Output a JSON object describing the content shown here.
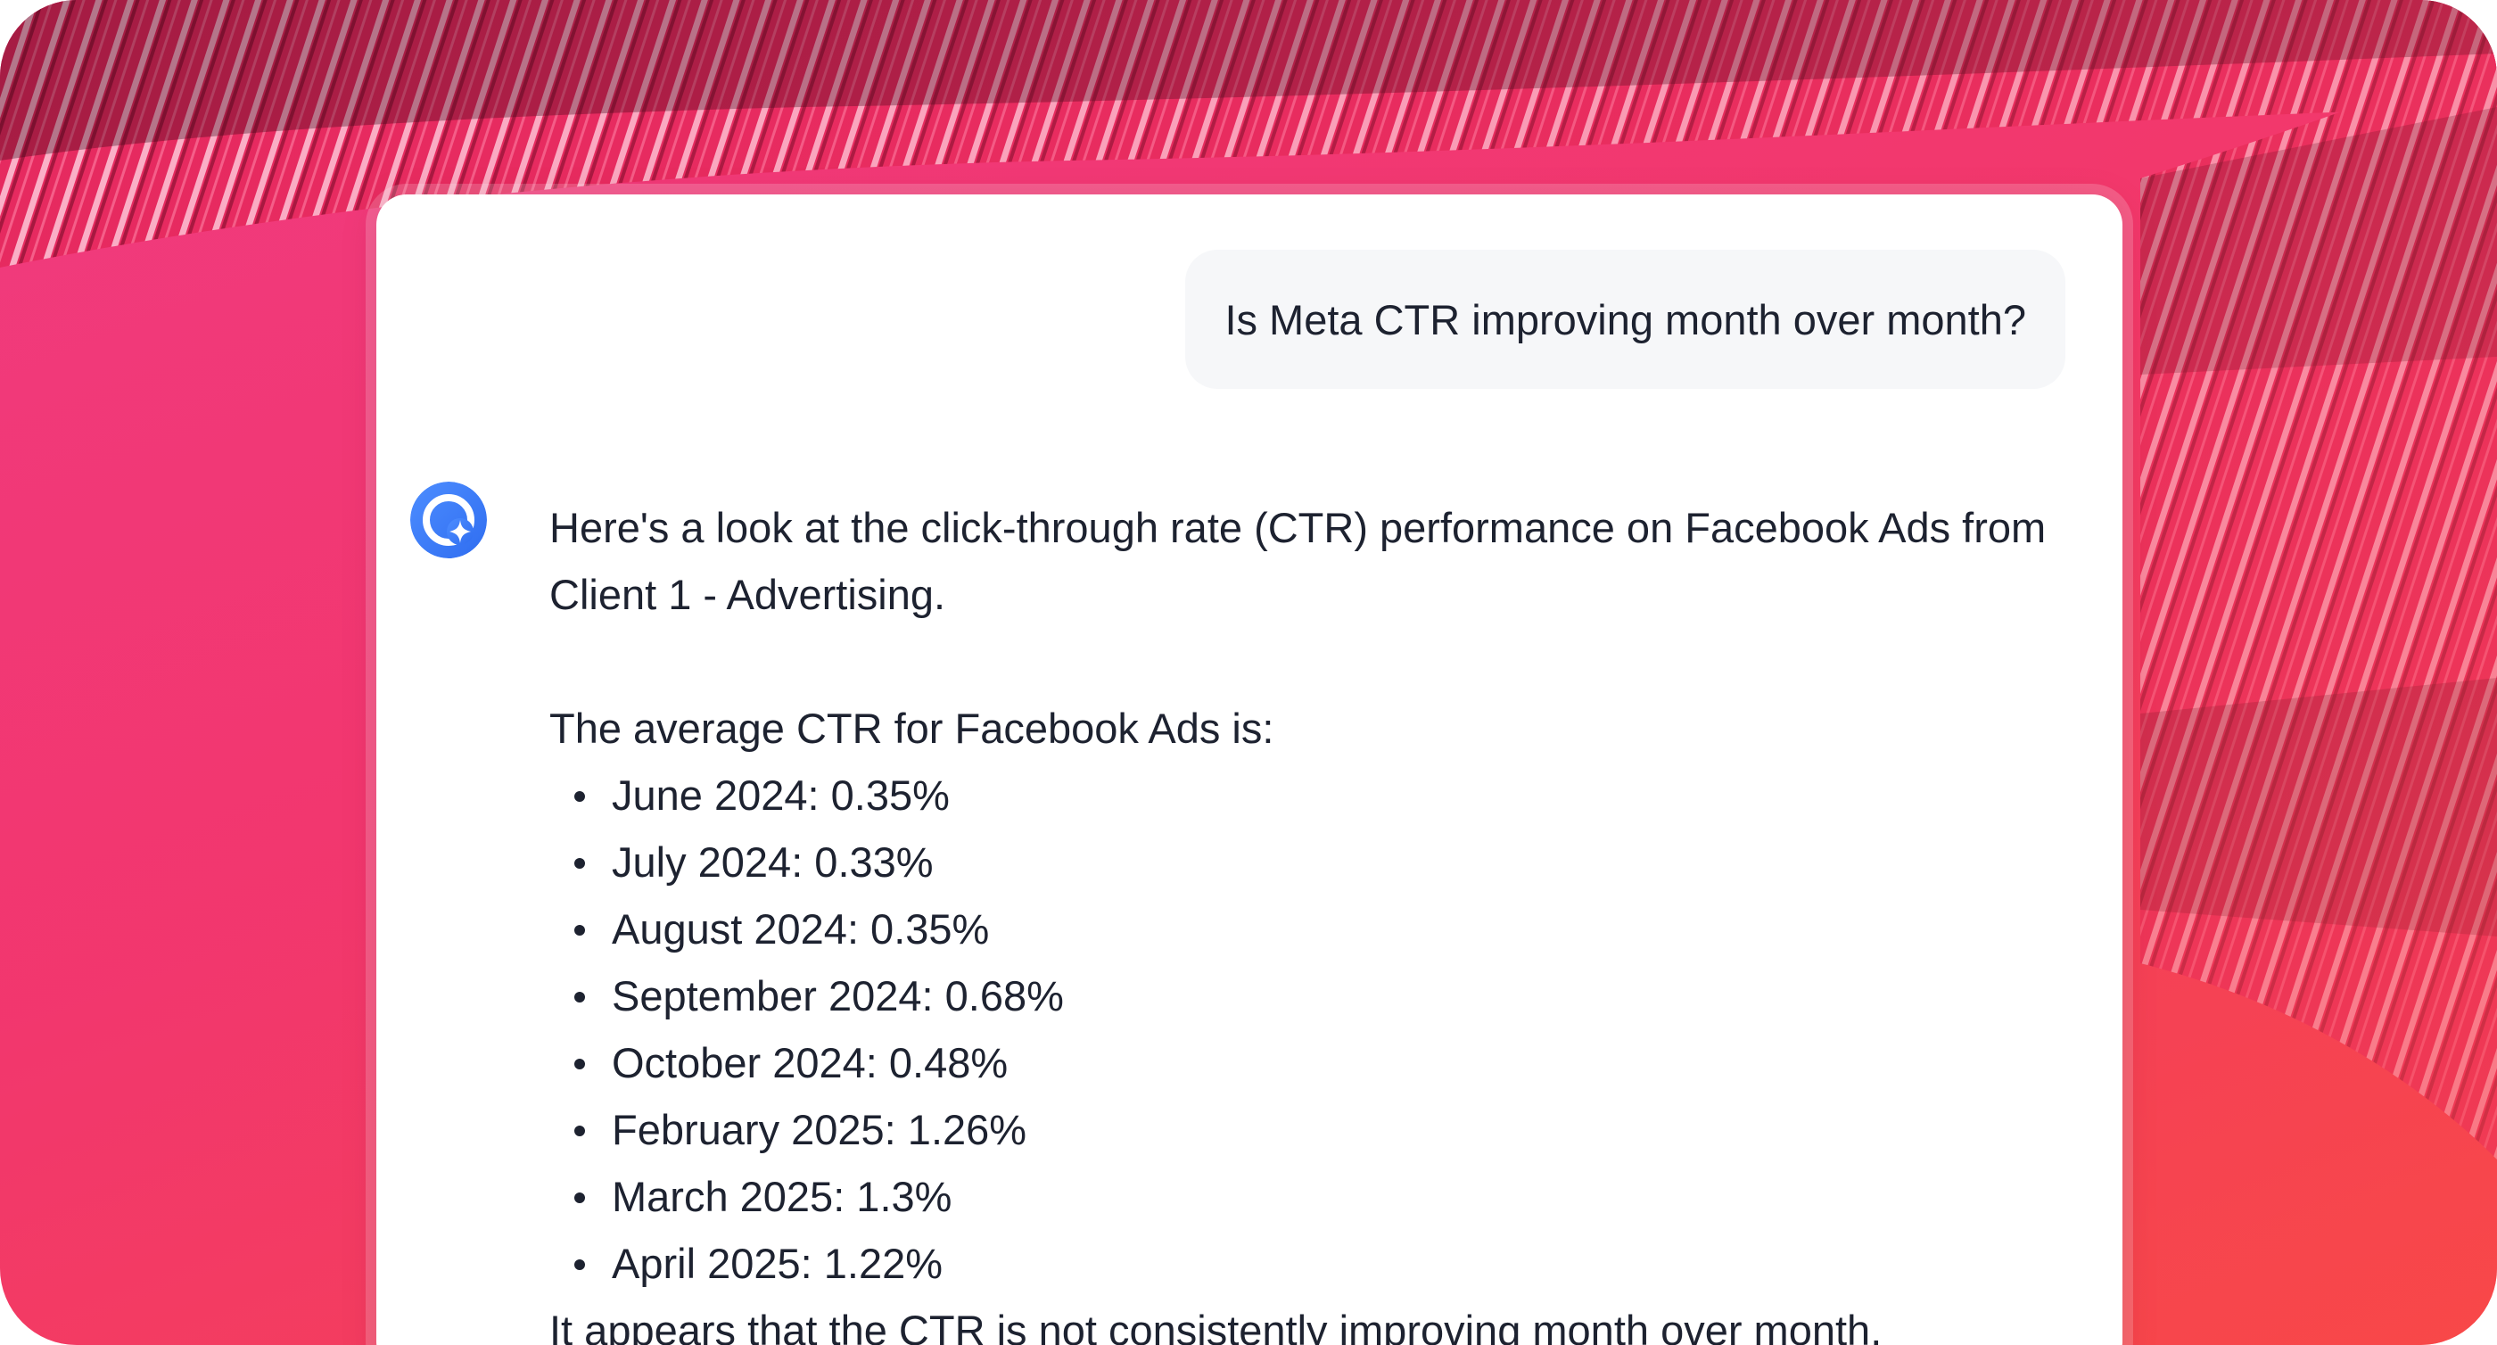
{
  "conversation": {
    "user_message": "Is Meta CTR improving month over month?",
    "assistant": {
      "avatar_icon": "assistant-sparkle-logo-icon",
      "intro": "Here's a look at the click-through rate (CTR) performance on Facebook Ads from Client 1 - Advertising.",
      "list_heading": "The average CTR for Facebook Ads is:",
      "items": [
        "June 2024: 0.35%",
        "July 2024: 0.33%",
        "August 2024: 0.35%",
        "September 2024: 0.68%",
        "October 2024: 0.48%",
        "February 2025: 1.26%",
        "March 2025: 1.3%",
        "April 2025: 1.22%"
      ],
      "conclusion": "It appears that the CTR is not consistently improving month over month."
    }
  },
  "colors": {
    "background_pink": "#f23673",
    "background_red": "#f84848",
    "avatar_blue": "#3b82f6",
    "user_bubble": "#f6f7f9",
    "text": "#1d2230"
  }
}
